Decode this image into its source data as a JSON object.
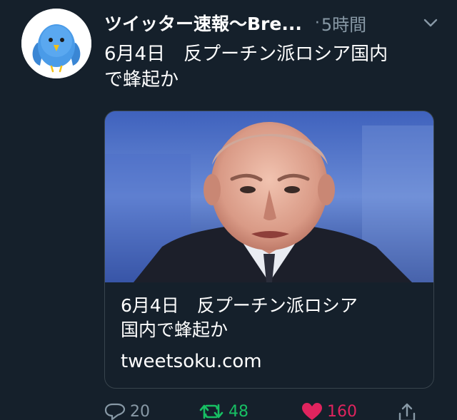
{
  "author": {
    "name": "ツイッター速報〜Bre...",
    "separator": "·",
    "timestamp": "5時間"
  },
  "tweet": {
    "text": "6月4日　反プーチン派ロシア国内\nで蜂起か"
  },
  "card": {
    "title": "6月4日　反プーチン派ロシア\n国内で蜂起か",
    "domain": "tweetsoku.com"
  },
  "actions": {
    "reply_count": "20",
    "retweet_count": "48",
    "like_count": "160"
  },
  "colors": {
    "background": "#15202b",
    "secondary_text": "#8899a6",
    "retweet_active": "#17bf63",
    "like_active": "#e0245e",
    "card_border": "#38444d"
  },
  "icons": {
    "avatar": "blue-bird-icon",
    "caret": "chevron-down-icon",
    "reply": "reply-icon",
    "retweet": "retweet-icon",
    "like": "heart-icon",
    "share": "share-icon"
  }
}
